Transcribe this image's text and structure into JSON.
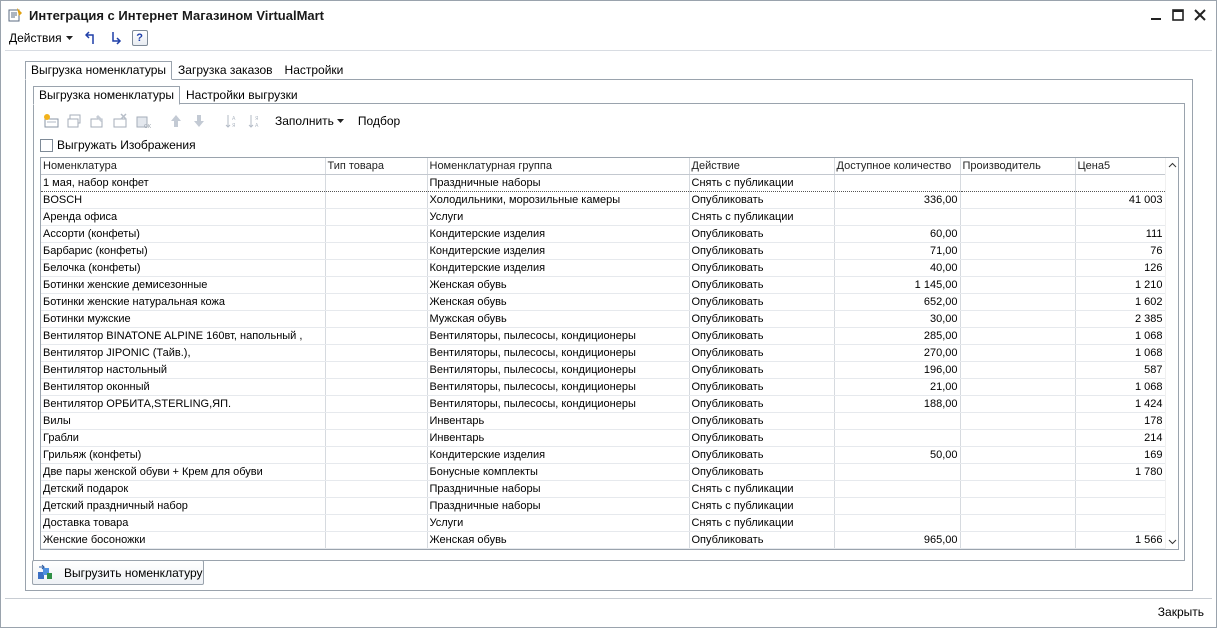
{
  "window": {
    "title": "Интеграция с Интернет Магазином VirtualMart"
  },
  "toolbar": {
    "actions_label": "Действия",
    "help_label": "?"
  },
  "outer_tabs": [
    {
      "label": "Выгрузка номенклатуры"
    },
    {
      "label": "Загрузка заказов"
    },
    {
      "label": "Настройки"
    }
  ],
  "inner_tabs": [
    {
      "label": "Выгрузка номенклатуры"
    },
    {
      "label": "Настройки выгрузки"
    }
  ],
  "inner_toolbar": {
    "fill_label": "Заполнить",
    "pick_label": "Подбор"
  },
  "images_checkbox": {
    "label": "Выгружать Изображения"
  },
  "table": {
    "columns": [
      "Номенклатура",
      "Тип товара",
      "Номенклатурная группа",
      "Действие",
      "Доступное количество",
      "Производитель",
      "Цена5"
    ],
    "rows": [
      [
        "1 мая, набор конфет",
        "",
        "Праздничные наборы",
        "Снять с публикации",
        "",
        "",
        ""
      ],
      [
        "BOSCH",
        "",
        "Холодильники, морозильные камеры",
        "Опубликовать",
        "336,00",
        "",
        "41 003"
      ],
      [
        "Аренда офиса",
        "",
        "Услуги",
        "Снять с публикации",
        "",
        "",
        ""
      ],
      [
        "Ассорти (конфеты)",
        "",
        "Кондитерские изделия",
        "Опубликовать",
        "60,00",
        "",
        "111"
      ],
      [
        "Барбарис (конфеты)",
        "",
        "Кондитерские изделия",
        "Опубликовать",
        "71,00",
        "",
        "76"
      ],
      [
        "Белочка (конфеты)",
        "",
        "Кондитерские изделия",
        "Опубликовать",
        "40,00",
        "",
        "126"
      ],
      [
        "Ботинки женские демисезонные",
        "",
        "Женская обувь",
        "Опубликовать",
        "1 145,00",
        "",
        "1 210"
      ],
      [
        "Ботинки женские натуральная кожа",
        "",
        "Женская обувь",
        "Опубликовать",
        "652,00",
        "",
        "1 602"
      ],
      [
        "Ботинки мужские",
        "",
        "Мужская обувь",
        "Опубликовать",
        "30,00",
        "",
        "2 385"
      ],
      [
        "Вентилятор BINATONE ALPINE 160вт, напольный ,",
        "",
        "Вентиляторы, пылесосы, кондиционеры",
        "Опубликовать",
        "285,00",
        "",
        "1 068"
      ],
      [
        "Вентилятор JIPONIC (Тайв.),",
        "",
        "Вентиляторы, пылесосы, кондиционеры",
        "Опубликовать",
        "270,00",
        "",
        "1 068"
      ],
      [
        "Вентилятор настольный",
        "",
        "Вентиляторы, пылесосы, кондиционеры",
        "Опубликовать",
        "196,00",
        "",
        "587"
      ],
      [
        "Вентилятор оконный",
        "",
        "Вентиляторы, пылесосы, кондиционеры",
        "Опубликовать",
        "21,00",
        "",
        "1 068"
      ],
      [
        "Вентилятор ОРБИТА,STERLING,ЯП.",
        "",
        "Вентиляторы, пылесосы, кондиционеры",
        "Опубликовать",
        "188,00",
        "",
        "1 424"
      ],
      [
        "Вилы",
        "",
        "Инвентарь",
        "Опубликовать",
        "",
        "",
        "178"
      ],
      [
        "Грабли",
        "",
        "Инвентарь",
        "Опубликовать",
        "",
        "",
        "214"
      ],
      [
        "Грильяж (конфеты)",
        "",
        "Кондитерские изделия",
        "Опубликовать",
        "50,00",
        "",
        "169"
      ],
      [
        "Две пары женской обуви + Крем для обуви",
        "",
        "Бонусные комплекты",
        "Опубликовать",
        "",
        "",
        "1 780"
      ],
      [
        "Детский подарок",
        "",
        "Праздничные наборы",
        "Снять с публикации",
        "",
        "",
        ""
      ],
      [
        "Детский праздничный набор",
        "",
        "Праздничные наборы",
        "Снять с публикации",
        "",
        "",
        ""
      ],
      [
        "Доставка товара",
        "",
        "Услуги",
        "Снять с публикации",
        "",
        "",
        ""
      ],
      [
        "Женские босоножки",
        "",
        "Женская обувь",
        "Опубликовать",
        "965,00",
        "",
        "1 566"
      ]
    ]
  },
  "export_button": {
    "label": "Выгрузить номенклатуру"
  },
  "footer": {
    "close_label": "Закрыть"
  }
}
